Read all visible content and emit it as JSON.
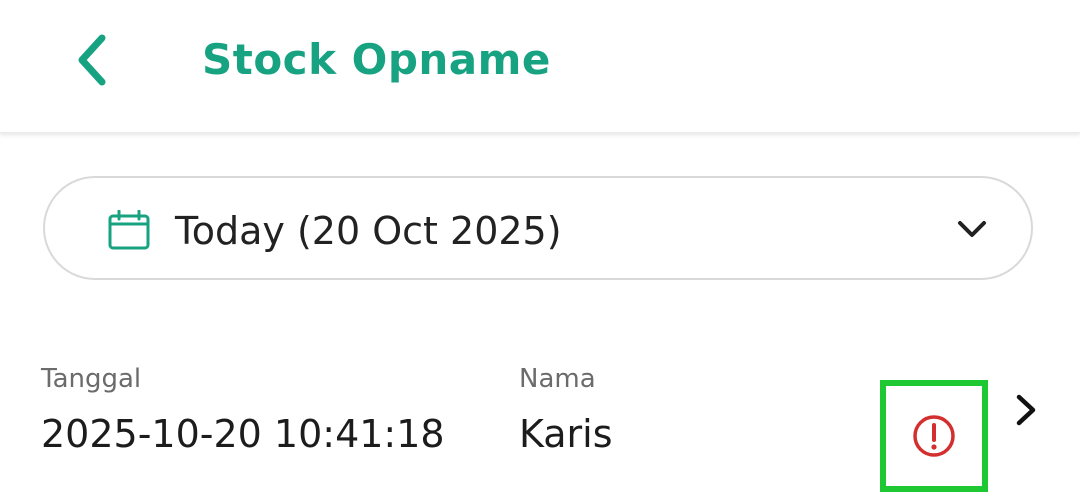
{
  "header": {
    "title": "Stock Opname",
    "back_icon": "chevron-left-icon",
    "accent_color": "#17a382"
  },
  "date_filter": {
    "icon": "calendar-icon",
    "label": "Today (20 Oct 2025)",
    "dropdown_icon": "chevron-down-icon"
  },
  "records": [
    {
      "date_label": "Tanggal",
      "date_value": "2025-10-20 10:41:18",
      "name_label": "Nama",
      "name_value": "Karis",
      "status_icon": "alert-circle-icon",
      "status_color": "#d32f2f",
      "highlight_color": "#1ec832",
      "open_icon": "chevron-right-icon"
    }
  ]
}
